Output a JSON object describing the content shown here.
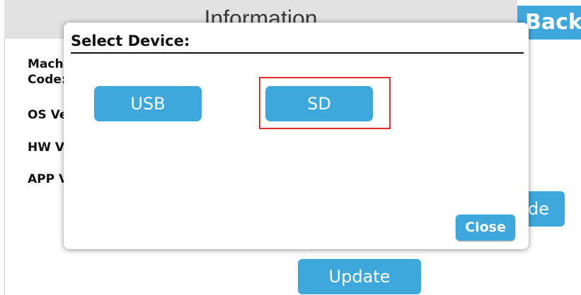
{
  "header": {
    "title": "Information",
    "back_label": "Back"
  },
  "info": {
    "machine_code_line1": "Mach",
    "machine_code_line2": "Code:",
    "os_version": "OS Ve",
    "hw_version": "HW V",
    "app_version": "APP V"
  },
  "background_buttons": {
    "partial_button_label": "de",
    "update_label": "Update"
  },
  "dialog": {
    "title": "Select Device:",
    "options": [
      "USB",
      "SD"
    ],
    "highlighted_option": "SD",
    "close_label": "Close"
  },
  "colors": {
    "accent": "#3ea8dc",
    "highlight": "#e52b2b",
    "header_bg": "#e2e2e2"
  }
}
